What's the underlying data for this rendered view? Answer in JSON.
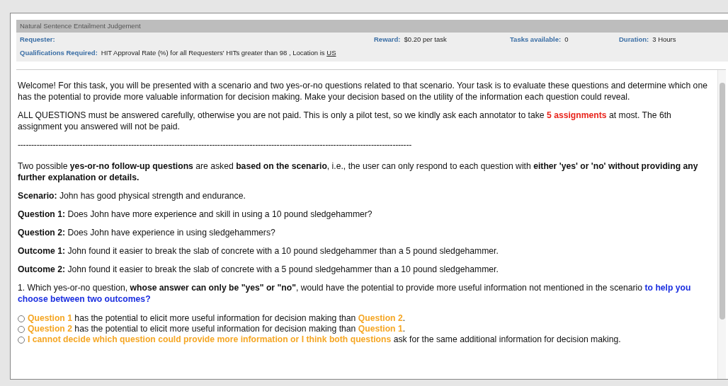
{
  "header": {
    "title": "Natural Sentence Entailment Judgement",
    "fields": [
      {
        "label": "Requester:"
      },
      {
        "label": "Reward:",
        "value": "$0.20 per task"
      },
      {
        "label": "Tasks available:",
        "value": "0"
      },
      {
        "label": "Duration:",
        "value": "3 Hours"
      }
    ],
    "qualifications": {
      "label": "Qualifications Required:",
      "value": "HIT Approval Rate (%) for all Requesters' HITs greater than 98 , Location is",
      "location": "US"
    }
  },
  "paragraphs": [
    {
      "kind": "text",
      "segments": [
        {
          "kind": "plain",
          "text": "Welcome! For this task, you will be presented with a scenario and two yes-or-no questions related to that scenario. Your task is to evaluate these questions and determine which one has the potential to provide more valuable information for decision making. Make your decision based on the utility of the information each question could reveal."
        }
      ]
    },
    {
      "kind": "text",
      "segments": [
        {
          "kind": "plain",
          "text": "ALL QUESTIONS must be answered carefully, otherwise you are not paid. This is only a pilot test, so we kindly ask each annotator to take "
        },
        {
          "kind": "warning",
          "text": "5 assignments"
        },
        {
          "kind": "plain",
          "text": " at most. The 6th assignment you answered will not be paid."
        }
      ]
    },
    {
      "kind": "divider",
      "segments": [
        {
          "kind": "plain",
          "text": "--------------------------------------------------------------------------------------------------------------------------------------------------"
        }
      ]
    },
    {
      "kind": "text",
      "segments": [
        {
          "kind": "plain",
          "text": "Two possible "
        },
        {
          "kind": "bold",
          "text": "yes-or-no follow-up questions"
        },
        {
          "kind": "plain",
          "text": " are asked "
        },
        {
          "kind": "bold",
          "text": "based on the scenario"
        },
        {
          "kind": "plain",
          "text": ", i.e., the user can only respond to each question with "
        },
        {
          "kind": "bold",
          "text": "either 'yes' or 'no' without providing any further explanation or details."
        }
      ]
    },
    {
      "kind": "text",
      "segments": [
        {
          "kind": "bold",
          "text": "Scenario:"
        },
        {
          "kind": "plain",
          "text": " John has good physical strength and endurance."
        }
      ]
    },
    {
      "kind": "text",
      "segments": [
        {
          "kind": "bold",
          "text": "Question 1:"
        },
        {
          "kind": "plain",
          "text": " Does John have more experience and skill in using a 10 pound sledgehammer?"
        }
      ]
    },
    {
      "kind": "text",
      "segments": [
        {
          "kind": "bold",
          "text": "Question 2:"
        },
        {
          "kind": "plain",
          "text": " Does John have experience in using sledgehammers?"
        }
      ]
    },
    {
      "kind": "text",
      "segments": [
        {
          "kind": "bold",
          "text": "Outcome 1:"
        },
        {
          "kind": "plain",
          "text": " John found it easier to break the slab of concrete with a 10 pound sledgehammer than a 5 pound sledgehammer."
        }
      ]
    },
    {
      "kind": "text",
      "segments": [
        {
          "kind": "bold",
          "text": "Outcome 2:"
        },
        {
          "kind": "plain",
          "text": " John found it easier to break the slab of concrete with a 5 pound sledgehammer than a 10 pound sledgehammer."
        }
      ]
    },
    {
      "kind": "text",
      "segments": [
        {
          "kind": "plain",
          "text": "1. Which yes-or-no question, "
        },
        {
          "kind": "bold",
          "text": "whose answer can only be \"yes\" or \"no\""
        },
        {
          "kind": "plain",
          "text": ", would have the potential to provide more useful information not mentioned in the scenario "
        },
        {
          "kind": "prompt",
          "text": "to help you choose between two outcomes?"
        }
      ]
    }
  ],
  "options": [
    {
      "selected": false,
      "segments": [
        {
          "kind": "reference",
          "text": "Question 1"
        },
        {
          "kind": "plain",
          "text": " has the potential to elicit more useful information for decision making than "
        },
        {
          "kind": "reference",
          "text": "Question 2"
        },
        {
          "kind": "plain",
          "text": "."
        }
      ]
    },
    {
      "selected": false,
      "segments": [
        {
          "kind": "reference",
          "text": "Question 2"
        },
        {
          "kind": "plain",
          "text": " has the potential to elicit more useful information for decision making than "
        },
        {
          "kind": "reference",
          "text": "Question 1"
        },
        {
          "kind": "plain",
          "text": "."
        }
      ]
    },
    {
      "selected": false,
      "segments": [
        {
          "kind": "reference",
          "text": "I cannot decide which question could provide more information or I think both questions"
        },
        {
          "kind": "plain",
          "text": " ask for the same additional information for decision making."
        }
      ]
    }
  ]
}
